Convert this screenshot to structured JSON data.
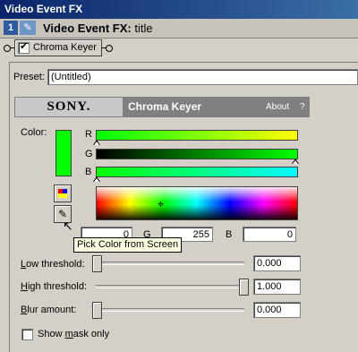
{
  "window": {
    "title": "Video Event FX"
  },
  "header": {
    "number": "1",
    "label": "Video Event FX:",
    "name": "title"
  },
  "chain": {
    "plugin_label": "Chroma Keyer"
  },
  "preset": {
    "label": "Preset:",
    "value": "(Untitled)"
  },
  "banner": {
    "brand": "SONY.",
    "plugin_name": "Chroma Keyer",
    "about": "About",
    "help": "?"
  },
  "color": {
    "label": "Color:",
    "swatch": "#00ff00",
    "r_label": "R",
    "g_label": "G",
    "b_label": "B",
    "r_value": "0",
    "g_value": "255",
    "b_value": "0"
  },
  "tooltip": "Pick Color from Screen",
  "sliders": {
    "low": {
      "label_pre": "",
      "label_u": "L",
      "label_post": "ow threshold:",
      "value": "0.000",
      "level": 0.0
    },
    "high": {
      "label_pre": "",
      "label_u": "H",
      "label_post": "igh threshold:",
      "value": "1.000",
      "level": 1.0
    },
    "blur": {
      "label_pre": "",
      "label_u": "B",
      "label_post": "lur amount:",
      "value": "0.000",
      "level": 0.0
    }
  },
  "mask": {
    "label_pre": "Show ",
    "label_u": "m",
    "label_post": "ask only",
    "checked": false
  },
  "colors": {
    "titlebar": "#0a246a",
    "key_color": "#00ff00",
    "face": "#d4d0c8"
  }
}
